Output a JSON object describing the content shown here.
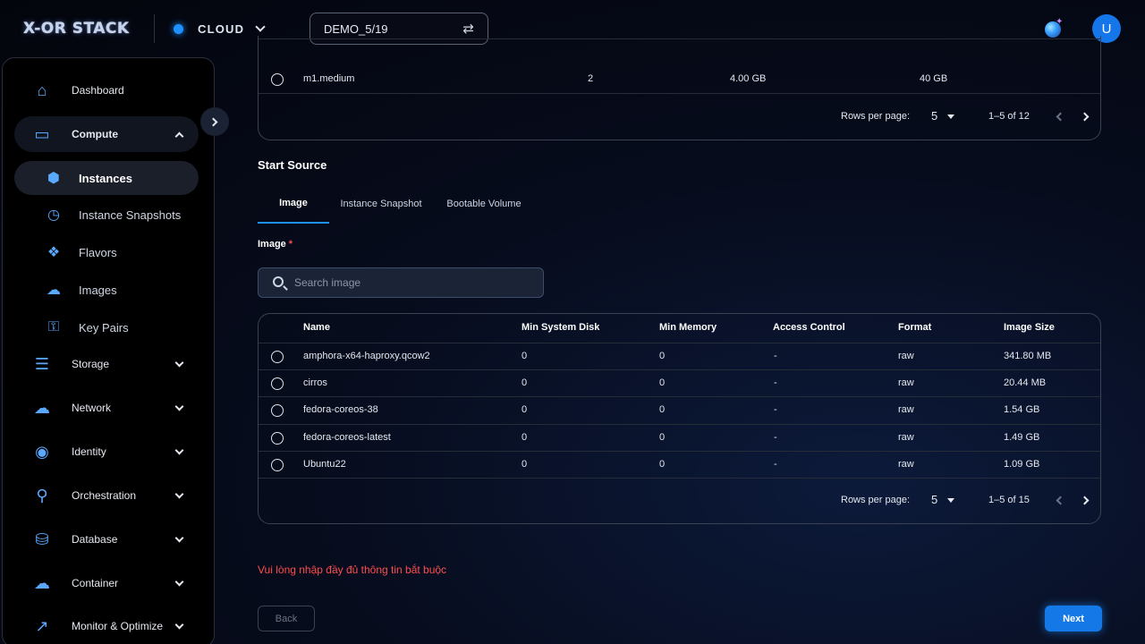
{
  "header": {
    "logo": "X-OR STACK",
    "cloud_label": "CLOUD",
    "project": "DEMO_5/19",
    "avatar_initial": "U"
  },
  "sidebar": {
    "items": [
      {
        "label": "Dashboard",
        "icon": "home-icon"
      },
      {
        "label": "Compute",
        "icon": "monitor-icon",
        "expanded": true,
        "children": [
          {
            "label": "Instances",
            "icon": "instance-icon",
            "active": true
          },
          {
            "label": "Instance Snapshots",
            "icon": "snapshot-icon"
          },
          {
            "label": "Flavors",
            "icon": "flavors-icon"
          },
          {
            "label": "Images",
            "icon": "images-icon"
          },
          {
            "label": "Key Pairs",
            "icon": "key-icon"
          }
        ]
      },
      {
        "label": "Storage",
        "icon": "storage-icon"
      },
      {
        "label": "Network",
        "icon": "network-icon"
      },
      {
        "label": "Identity",
        "icon": "identity-icon"
      },
      {
        "label": "Orchestration",
        "icon": "orchestration-icon"
      },
      {
        "label": "Database",
        "icon": "database-icon"
      },
      {
        "label": "Container",
        "icon": "container-icon"
      },
      {
        "label": "Monitor & Optimize",
        "icon": "monitor-chart-icon"
      }
    ]
  },
  "flavor_table": {
    "visible_row": {
      "name": "m1.medium",
      "vcpus": "2",
      "ram": "4.00 GB",
      "disk": "40 GB"
    },
    "pager": {
      "rows_per_page_label": "Rows per page:",
      "rows_per_page": "5",
      "range": "1–5 of 12"
    }
  },
  "start_source": {
    "title": "Start Source",
    "tabs": [
      "Image",
      "Instance Snapshot",
      "Bootable Volume"
    ],
    "active_tab": "Image",
    "field_label": "Image",
    "required_mark": "*",
    "search_placeholder": "Search image"
  },
  "image_table": {
    "headers": [
      "Name",
      "Min System Disk",
      "Min Memory",
      "Access Control",
      "Format",
      "Image Size"
    ],
    "rows": [
      [
        "amphora-x64-haproxy.qcow2",
        "0",
        "0",
        "-",
        "raw",
        "341.80 MB"
      ],
      [
        "cirros",
        "0",
        "0",
        "-",
        "raw",
        "20.44 MB"
      ],
      [
        "fedora-coreos-38",
        "0",
        "0",
        "-",
        "raw",
        "1.54 GB"
      ],
      [
        "fedora-coreos-latest",
        "0",
        "0",
        "-",
        "raw",
        "1.49 GB"
      ],
      [
        "Ubuntu22",
        "0",
        "0",
        "-",
        "raw",
        "1.09 GB"
      ]
    ],
    "pager": {
      "rows_per_page_label": "Rows per page:",
      "rows_per_page": "5",
      "range": "1–5 of 15"
    }
  },
  "error_message": "Vui lòng nhập đầy đủ thông tin bắt buộc",
  "footer": {
    "back_label": "Back",
    "next_label": "Next"
  },
  "colors": {
    "accent": "#1e90ff",
    "error": "#ff4d4f",
    "background": "#070c1d"
  }
}
